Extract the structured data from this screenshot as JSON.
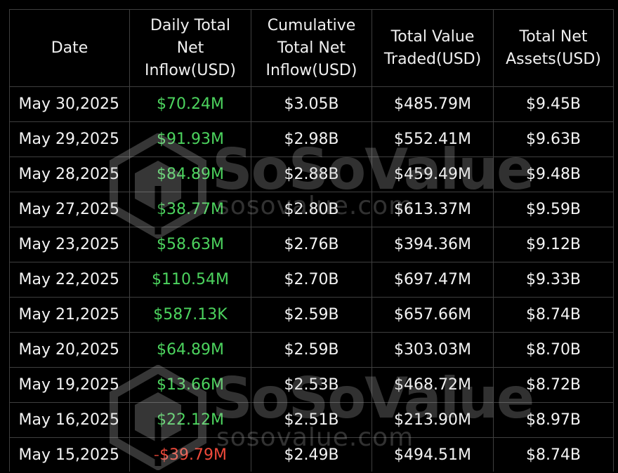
{
  "headers": [
    "Date",
    "Daily Total Net Inflow(USD)",
    "Cumulative Total Net Inflow(USD)",
    "Total Value Traded(USD)",
    "Total Net Assets(USD)"
  ],
  "rows": [
    {
      "date": "May 30,2025",
      "daily": "$70.24M",
      "daily_sign": "pos",
      "cumulative": "$3.05B",
      "traded": "$485.79M",
      "assets": "$9.45B"
    },
    {
      "date": "May 29,2025",
      "daily": "$91.93M",
      "daily_sign": "pos",
      "cumulative": "$2.98B",
      "traded": "$552.41M",
      "assets": "$9.63B"
    },
    {
      "date": "May 28,2025",
      "daily": "$84.89M",
      "daily_sign": "pos",
      "cumulative": "$2.88B",
      "traded": "$459.49M",
      "assets": "$9.48B"
    },
    {
      "date": "May 27,2025",
      "daily": "$38.77M",
      "daily_sign": "pos",
      "cumulative": "$2.80B",
      "traded": "$613.37M",
      "assets": "$9.59B"
    },
    {
      "date": "May 23,2025",
      "daily": "$58.63M",
      "daily_sign": "pos",
      "cumulative": "$2.76B",
      "traded": "$394.36M",
      "assets": "$9.12B"
    },
    {
      "date": "May 22,2025",
      "daily": "$110.54M",
      "daily_sign": "pos",
      "cumulative": "$2.70B",
      "traded": "$697.47M",
      "assets": "$9.33B"
    },
    {
      "date": "May 21,2025",
      "daily": "$587.13K",
      "daily_sign": "pos",
      "cumulative": "$2.59B",
      "traded": "$657.66M",
      "assets": "$8.74B"
    },
    {
      "date": "May 20,2025",
      "daily": "$64.89M",
      "daily_sign": "pos",
      "cumulative": "$2.59B",
      "traded": "$303.03M",
      "assets": "$8.70B"
    },
    {
      "date": "May 19,2025",
      "daily": "$13.66M",
      "daily_sign": "pos",
      "cumulative": "$2.53B",
      "traded": "$468.72M",
      "assets": "$8.72B"
    },
    {
      "date": "May 16,2025",
      "daily": "$22.12M",
      "daily_sign": "pos",
      "cumulative": "$2.51B",
      "traded": "$213.90M",
      "assets": "$8.97B"
    },
    {
      "date": "May 15,2025",
      "daily": "-$39.79M",
      "daily_sign": "neg",
      "cumulative": "$2.49B",
      "traded": "$494.51M",
      "assets": "$8.74B"
    }
  ],
  "watermark": {
    "brand": "SoSoValue",
    "url": "sosovalue.com",
    "icon": "sosovalue-cube-logo"
  },
  "colors": {
    "background": "#000000",
    "grid": "#3f3f3f",
    "text": "#f4f4f4",
    "positive": "#4cd35e",
    "negative": "#f04a3b"
  }
}
